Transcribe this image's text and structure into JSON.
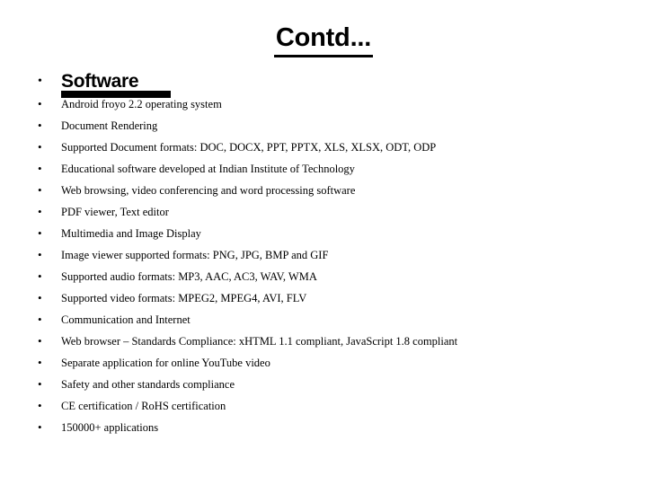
{
  "slide": {
    "title": "Contd...",
    "background_color": "#ffffff",
    "text_color": "#000000",
    "heading_underline_color": "#000000"
  },
  "outline": {
    "heading": {
      "bullet_glyph": "•",
      "label": "Software"
    },
    "bullet_glyph": "•",
    "items": [
      {
        "text": "Android froyo 2.2 operating system"
      },
      {
        "text": "Document Rendering"
      },
      {
        "text": "Supported Document formats: DOC, DOCX, PPT, PPTX, XLS, XLSX, ODT, ODP"
      },
      {
        "text": "Educational software developed at Indian Institute of Technology"
      },
      {
        "text": "Web browsing, video conferencing and word processing software"
      },
      {
        "text": "PDF viewer, Text editor"
      },
      {
        "text": "Multimedia and Image Display"
      },
      {
        "text": "Image viewer supported formats: PNG, JPG, BMP and GIF"
      },
      {
        "text": "Supported audio formats: MP3, AAC, AC3, WAV, WMA"
      },
      {
        "text": "Supported video formats: MPEG2, MPEG4, AVI, FLV"
      },
      {
        "text": "Communication and Internet"
      },
      {
        "text": "Web browser – Standards Compliance: xHTML 1.1 compliant, JavaScript 1.8 compliant"
      },
      {
        "text": "Separate application for online YouTube video"
      },
      {
        "text": "Safety and other standards compliance"
      },
      {
        "text": "CE certification / RoHS certification"
      },
      {
        "text": "150000+ applications"
      }
    ]
  }
}
